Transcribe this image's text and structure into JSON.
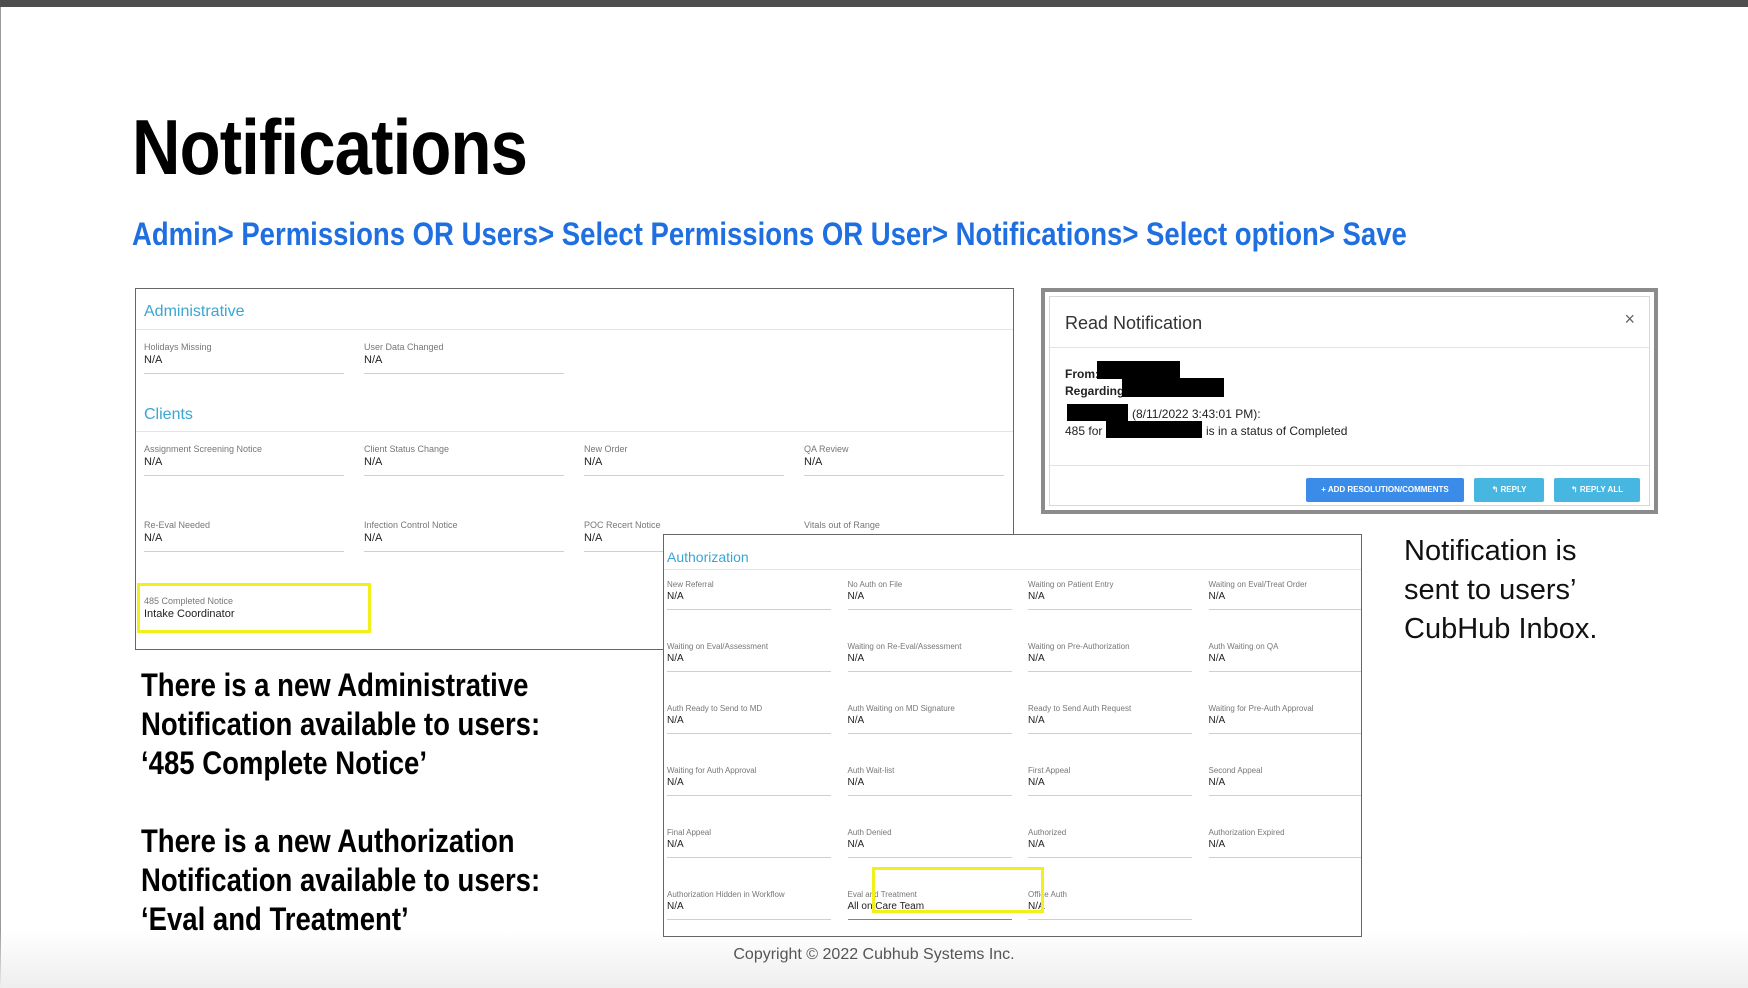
{
  "slide": {
    "title": "Notifications",
    "path": "Admin> Permissions OR Users> Select Permissions OR User> Notifications> Select option> Save",
    "side_note": [
      "Notification is",
      "sent to users’",
      "CubHub Inbox."
    ],
    "note1": [
      "There is a new Administrative",
      "Notification available to users:",
      "‘485 Complete Notice’"
    ],
    "note2": [
      "There is a new Authorization",
      "Notification available to users:",
      "‘Eval and Treatment’"
    ],
    "copyright": "Copyright © 2022 Cubhub Systems Inc."
  },
  "admin_panel": {
    "administrative_title": "Administrative",
    "administrative_fields": [
      {
        "label": "Holidays Missing",
        "value": "N/A"
      },
      {
        "label": "User Data Changed",
        "value": "N/A"
      }
    ],
    "clients_title": "Clients",
    "clients_fields": [
      {
        "label": "Assignment Screening Notice",
        "value": "N/A"
      },
      {
        "label": "Client Status Change",
        "value": "N/A"
      },
      {
        "label": "New Order",
        "value": "N/A"
      },
      {
        "label": "QA Review",
        "value": "N/A"
      },
      {
        "label": "Re-Eval Needed",
        "value": "N/A"
      },
      {
        "label": "Infection Control Notice",
        "value": "N/A"
      },
      {
        "label": "POC Recert Notice",
        "value": "N/A"
      },
      {
        "label": "Vitals out of Range",
        "value": ""
      },
      {
        "label": "485 Completed Notice",
        "value": "Intake Coordinator"
      }
    ]
  },
  "auth_panel": {
    "title": "Authorization",
    "fields": [
      {
        "label": "New Referral",
        "value": "N/A"
      },
      {
        "label": "No Auth on File",
        "value": "N/A"
      },
      {
        "label": "Waiting on Patient Entry",
        "value": "N/A"
      },
      {
        "label": "Waiting on Eval/Treat Order",
        "value": "N/A"
      },
      {
        "label": "Waiting on Eval/Assessment",
        "value": "N/A"
      },
      {
        "label": "Waiting on Re-Eval/Assessment",
        "value": "N/A"
      },
      {
        "label": "Waiting on Pre-Authorization",
        "value": "N/A"
      },
      {
        "label": "Auth Waiting on QA",
        "value": "N/A"
      },
      {
        "label": "Auth Ready to Send to MD",
        "value": "N/A"
      },
      {
        "label": "Auth Waiting on MD Signature",
        "value": "N/A"
      },
      {
        "label": "Ready to Send Auth Request",
        "value": "N/A"
      },
      {
        "label": "Waiting for Pre-Auth Approval",
        "value": "N/A"
      },
      {
        "label": "Waiting for Auth Approval",
        "value": "N/A"
      },
      {
        "label": "Auth Wait-list",
        "value": "N/A"
      },
      {
        "label": "First Appeal",
        "value": "N/A"
      },
      {
        "label": "Second Appeal",
        "value": "N/A"
      },
      {
        "label": "Final Appeal",
        "value": "N/A"
      },
      {
        "label": "Auth Denied",
        "value": "N/A"
      },
      {
        "label": "Authorized",
        "value": "N/A"
      },
      {
        "label": "Authorization Expired",
        "value": "N/A"
      },
      {
        "label": "Authorization Hidden in Workflow",
        "value": "N/A"
      },
      {
        "label": "Eval and Treatment",
        "value": "All on Care Team"
      },
      {
        "label": "Office Auth",
        "value": "N/A"
      }
    ]
  },
  "read_notification": {
    "title": "Read Notification",
    "close": "×",
    "from_label": "From:",
    "regarding_label": "Regarding:",
    "timestamp": "(8/11/2022 3:43:01 PM):",
    "body_prefix": "485 for",
    "body_suffix": "is in a status of Completed",
    "btn_add": "+ ADD RESOLUTION/COMMENTS",
    "btn_reply": "↰ REPLY",
    "btn_reply_all": "↰ REPLY ALL"
  }
}
